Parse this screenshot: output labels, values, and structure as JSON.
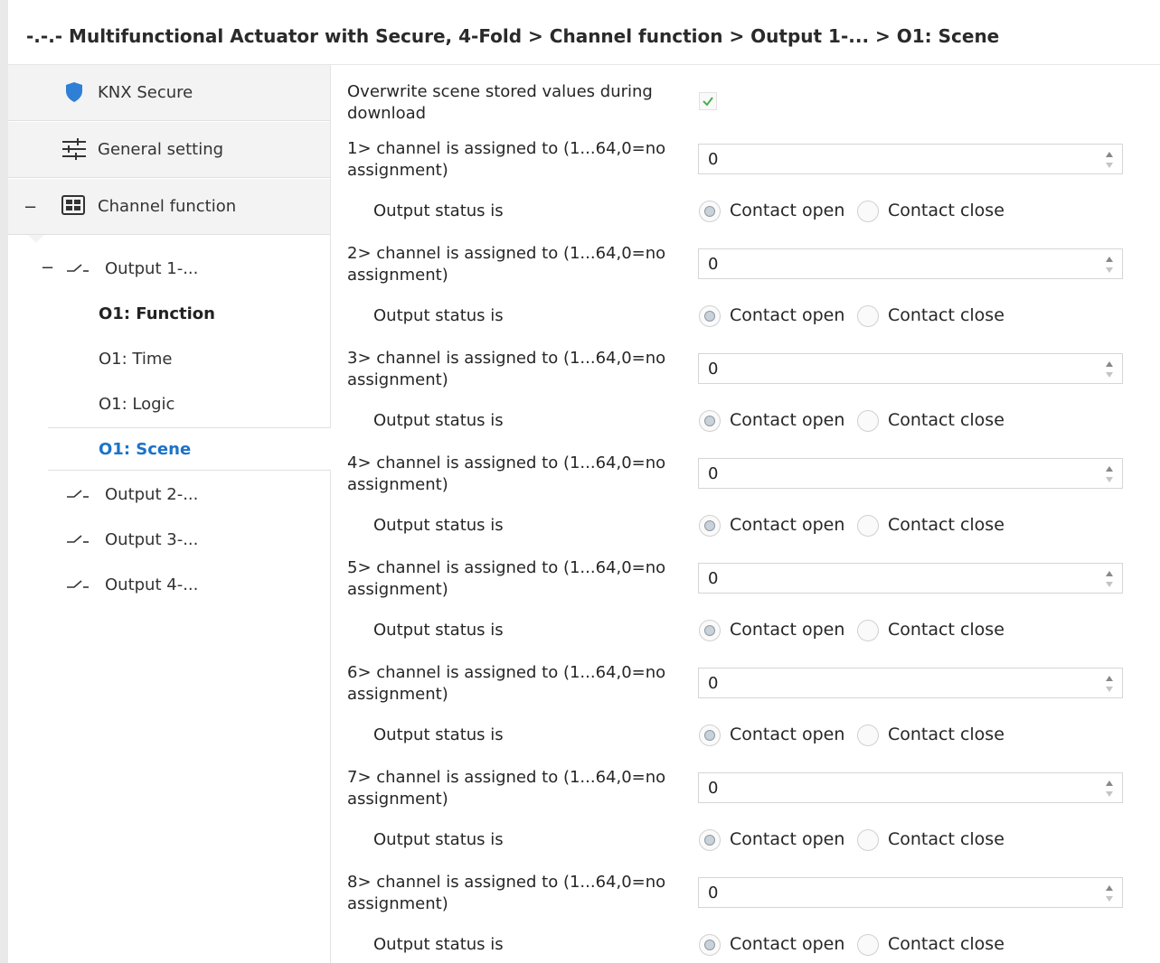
{
  "header": {
    "title": "-.-.- Multifunctional Actuator with Secure, 4-Fold > Channel function > Output 1-... > O1: Scene"
  },
  "sidebar": {
    "top_items": [
      {
        "label": "KNX Secure",
        "icon": "shield-icon"
      },
      {
        "label": "General setting",
        "icon": "sliders-icon"
      },
      {
        "label": "Channel function",
        "icon": "grid-icon",
        "expander": "−"
      }
    ],
    "output1": {
      "label": "Output 1-...",
      "expander": "−"
    },
    "sub_items": [
      {
        "label": "O1: Function"
      },
      {
        "label": "O1: Time"
      },
      {
        "label": "O1: Logic"
      },
      {
        "label": "O1: Scene"
      }
    ],
    "outputs": [
      {
        "label": "Output 2-..."
      },
      {
        "label": "Output 3-..."
      },
      {
        "label": "Output 4-..."
      }
    ]
  },
  "content": {
    "overwrite_label": "Overwrite scene stored values during download",
    "overwrite_checked": true,
    "status_label": "Output status is",
    "option_open": "Contact open",
    "option_close": "Contact close",
    "channels": [
      {
        "label": "1> channel is assigned to (1...64,0=no assignment)",
        "value": "0",
        "status": "Contact open"
      },
      {
        "label": "2> channel is assigned to (1...64,0=no assignment)",
        "value": "0",
        "status": "Contact open"
      },
      {
        "label": "3> channel is assigned to (1...64,0=no assignment)",
        "value": "0",
        "status": "Contact open"
      },
      {
        "label": "4> channel is assigned to (1...64,0=no assignment)",
        "value": "0",
        "status": "Contact open"
      },
      {
        "label": "5> channel is assigned to (1...64,0=no assignment)",
        "value": "0",
        "status": "Contact open"
      },
      {
        "label": "6> channel is assigned to (1...64,0=no assignment)",
        "value": "0",
        "status": "Contact open"
      },
      {
        "label": "7> channel is assigned to (1...64,0=no assignment)",
        "value": "0",
        "status": "Contact open"
      },
      {
        "label": "8> channel is assigned to (1...64,0=no assignment)",
        "value": "0",
        "status": "Contact open"
      }
    ]
  },
  "colors": {
    "accent": "#1a73c9",
    "shield": "#2f7fd6",
    "check": "#4caf50"
  }
}
